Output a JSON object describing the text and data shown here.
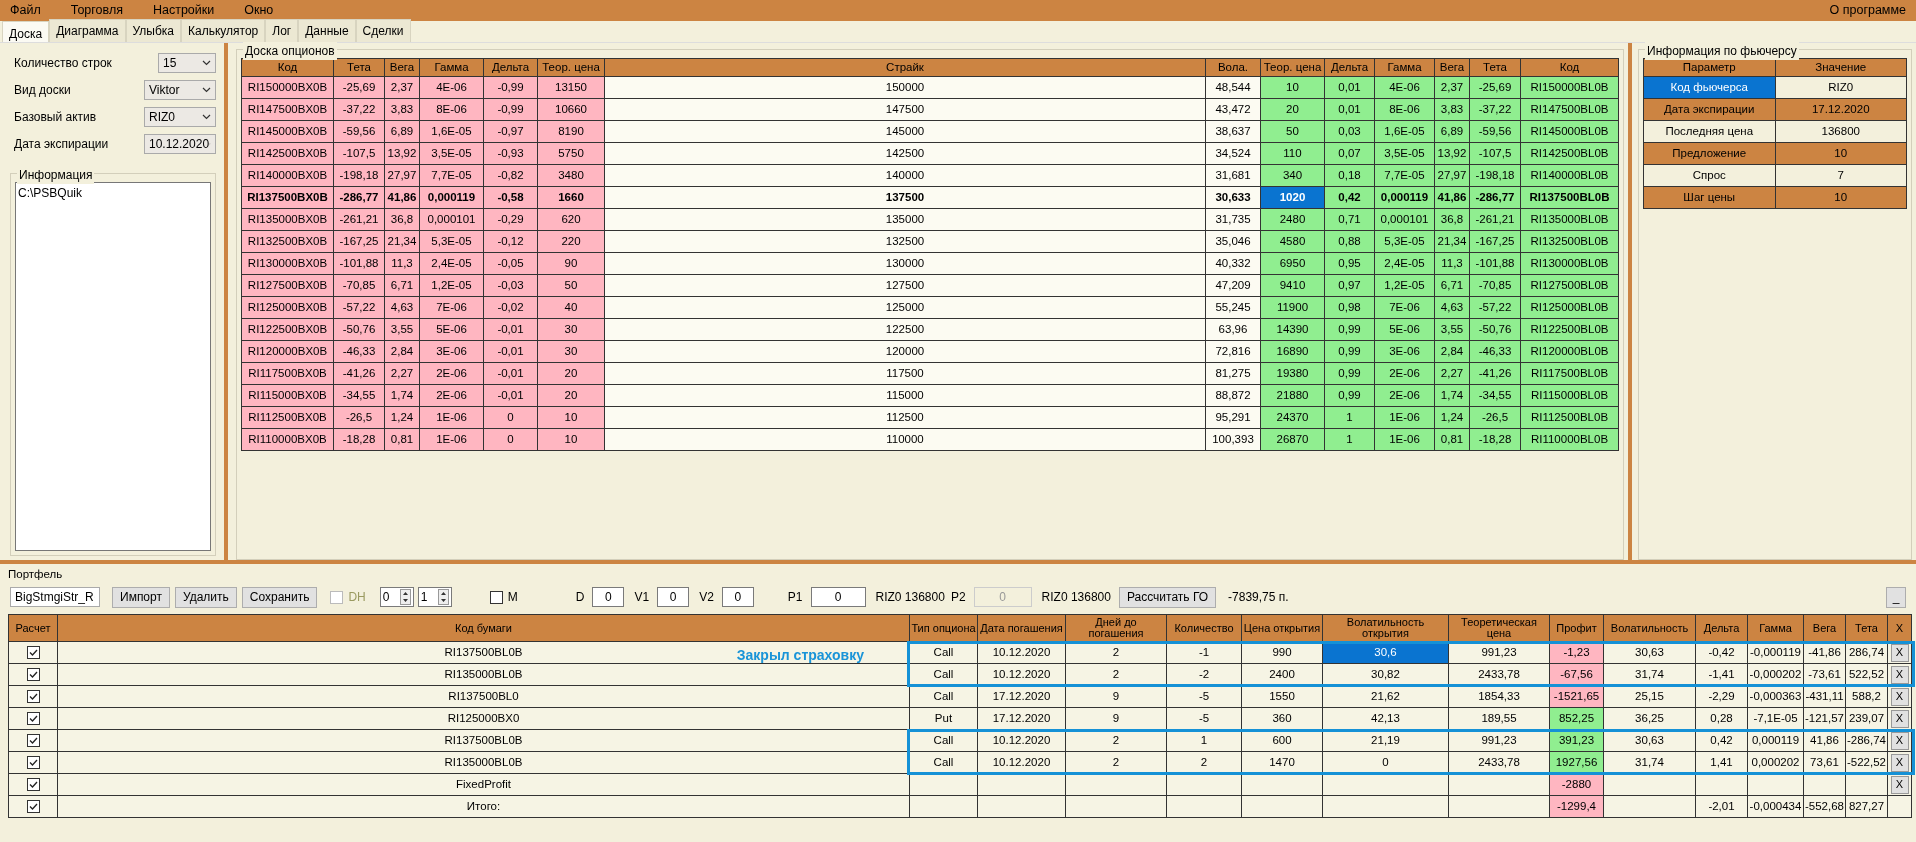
{
  "menu": [
    "Файл",
    "Торговля",
    "Настройки",
    "Окно"
  ],
  "about": "О программе",
  "tabs": [
    {
      "label": "Доска",
      "selected": true
    },
    {
      "label": "Диаграмма",
      "selected": false
    },
    {
      "label": "Улыбка",
      "selected": false
    },
    {
      "label": "Калькулятор",
      "selected": false
    },
    {
      "label": "Лог",
      "selected": false
    },
    {
      "label": "Данные",
      "selected": false
    },
    {
      "label": "Сделки",
      "selected": false
    }
  ],
  "settings": [
    {
      "label": "Количество строк",
      "value": "15"
    },
    {
      "label": "Вид доски",
      "value": "Viktor"
    },
    {
      "label": "Базовый актив",
      "value": "RIZ0"
    },
    {
      "label": "Дата экспирации",
      "value": "10.12.2020"
    }
  ],
  "info": {
    "title": "Информация",
    "text": "C:\\PSBQuik"
  },
  "board": {
    "title": "Доска опционов",
    "columns": [
      "Код",
      "Тета",
      "Вега",
      "Гамма",
      "Дельта",
      "Теор. цена",
      "Страйк",
      "Вола.",
      "Теор. цена",
      "Дельта",
      "Гамма",
      "Вега",
      "Тета",
      "Код"
    ],
    "rows": [
      {
        "put": [
          "RI150000BX0B",
          "-25,69",
          "2,37",
          "4E-06",
          "-0,99",
          "13150"
        ],
        "strike": "150000",
        "vol": "48,544",
        "call": [
          "10",
          "0,01",
          "4E-06",
          "2,37",
          "-25,69",
          "RI150000BL0B"
        ],
        "atm": false,
        "price_selected": false
      },
      {
        "put": [
          "RI147500BX0B",
          "-37,22",
          "3,83",
          "8E-06",
          "-0,99",
          "10660"
        ],
        "strike": "147500",
        "vol": "43,472",
        "call": [
          "20",
          "0,01",
          "8E-06",
          "3,83",
          "-37,22",
          "RI147500BL0B"
        ],
        "atm": false,
        "price_selected": false
      },
      {
        "put": [
          "RI145000BX0B",
          "-59,56",
          "6,89",
          "1,6E-05",
          "-0,97",
          "8190"
        ],
        "strike": "145000",
        "vol": "38,637",
        "call": [
          "50",
          "0,03",
          "1,6E-05",
          "6,89",
          "-59,56",
          "RI145000BL0B"
        ],
        "atm": false,
        "price_selected": false
      },
      {
        "put": [
          "RI142500BX0B",
          "-107,5",
          "13,92",
          "3,5E-05",
          "-0,93",
          "5750"
        ],
        "strike": "142500",
        "vol": "34,524",
        "call": [
          "110",
          "0,07",
          "3,5E-05",
          "13,92",
          "-107,5",
          "RI142500BL0B"
        ],
        "atm": false,
        "price_selected": false
      },
      {
        "put": [
          "RI140000BX0B",
          "-198,18",
          "27,97",
          "7,7E-05",
          "-0,82",
          "3480"
        ],
        "strike": "140000",
        "vol": "31,681",
        "call": [
          "340",
          "0,18",
          "7,7E-05",
          "27,97",
          "-198,18",
          "RI140000BL0B"
        ],
        "atm": false,
        "price_selected": false
      },
      {
        "put": [
          "RI137500BX0B",
          "-286,77",
          "41,86",
          "0,000119",
          "-0,58",
          "1660"
        ],
        "strike": "137500",
        "vol": "30,633",
        "call": [
          "1020",
          "0,42",
          "0,000119",
          "41,86",
          "-286,77",
          "RI137500BL0B"
        ],
        "atm": true,
        "price_selected": true
      },
      {
        "put": [
          "RI135000BX0B",
          "-261,21",
          "36,8",
          "0,000101",
          "-0,29",
          "620"
        ],
        "strike": "135000",
        "vol": "31,735",
        "call": [
          "2480",
          "0,71",
          "0,000101",
          "36,8",
          "-261,21",
          "RI135000BL0B"
        ],
        "atm": false,
        "price_selected": false
      },
      {
        "put": [
          "RI132500BX0B",
          "-167,25",
          "21,34",
          "5,3E-05",
          "-0,12",
          "220"
        ],
        "strike": "132500",
        "vol": "35,046",
        "call": [
          "4580",
          "0,88",
          "5,3E-05",
          "21,34",
          "-167,25",
          "RI132500BL0B"
        ],
        "atm": false,
        "price_selected": false
      },
      {
        "put": [
          "RI130000BX0B",
          "-101,88",
          "11,3",
          "2,4E-05",
          "-0,05",
          "90"
        ],
        "strike": "130000",
        "vol": "40,332",
        "call": [
          "6950",
          "0,95",
          "2,4E-05",
          "11,3",
          "-101,88",
          "RI130000BL0B"
        ],
        "atm": false,
        "price_selected": false
      },
      {
        "put": [
          "RI127500BX0B",
          "-70,85",
          "6,71",
          "1,2E-05",
          "-0,03",
          "50"
        ],
        "strike": "127500",
        "vol": "47,209",
        "call": [
          "9410",
          "0,97",
          "1,2E-05",
          "6,71",
          "-70,85",
          "RI127500BL0B"
        ],
        "atm": false,
        "price_selected": false
      },
      {
        "put": [
          "RI125000BX0B",
          "-57,22",
          "4,63",
          "7E-06",
          "-0,02",
          "40"
        ],
        "strike": "125000",
        "vol": "55,245",
        "call": [
          "11900",
          "0,98",
          "7E-06",
          "4,63",
          "-57,22",
          "RI125000BL0B"
        ],
        "atm": false,
        "price_selected": false
      },
      {
        "put": [
          "RI122500BX0B",
          "-50,76",
          "3,55",
          "5E-06",
          "-0,01",
          "30"
        ],
        "strike": "122500",
        "vol": "63,96",
        "call": [
          "14390",
          "0,99",
          "5E-06",
          "3,55",
          "-50,76",
          "RI122500BL0B"
        ],
        "atm": false,
        "price_selected": false
      },
      {
        "put": [
          "RI120000BX0B",
          "-46,33",
          "2,84",
          "3E-06",
          "-0,01",
          "30"
        ],
        "strike": "120000",
        "vol": "72,816",
        "call": [
          "16890",
          "0,99",
          "3E-06",
          "2,84",
          "-46,33",
          "RI120000BL0B"
        ],
        "atm": false,
        "price_selected": false
      },
      {
        "put": [
          "RI117500BX0B",
          "-41,26",
          "2,27",
          "2E-06",
          "-0,01",
          "20"
        ],
        "strike": "117500",
        "vol": "81,275",
        "call": [
          "19380",
          "0,99",
          "2E-06",
          "2,27",
          "-41,26",
          "RI117500BL0B"
        ],
        "atm": false,
        "price_selected": false
      },
      {
        "put": [
          "RI115000BX0B",
          "-34,55",
          "1,74",
          "2E-06",
          "-0,01",
          "20"
        ],
        "strike": "115000",
        "vol": "88,872",
        "call": [
          "21880",
          "0,99",
          "2E-06",
          "1,74",
          "-34,55",
          "RI115000BL0B"
        ],
        "atm": false,
        "price_selected": false
      },
      {
        "put": [
          "RI112500BX0B",
          "-26,5",
          "1,24",
          "1E-06",
          "0",
          "10"
        ],
        "strike": "112500",
        "vol": "95,291",
        "call": [
          "24370",
          "1",
          "1E-06",
          "1,24",
          "-26,5",
          "RI112500BL0B"
        ],
        "atm": false,
        "price_selected": false
      },
      {
        "put": [
          "RI110000BX0B",
          "-18,28",
          "0,81",
          "1E-06",
          "0",
          "10"
        ],
        "strike": "110000",
        "vol": "100,393",
        "call": [
          "26870",
          "1",
          "1E-06",
          "0,81",
          "-18,28",
          "RI110000BL0B"
        ],
        "atm": false,
        "price_selected": false
      }
    ]
  },
  "futures": {
    "title": "Информация по фьючерсу",
    "columns": [
      "Параметр",
      "Значение"
    ],
    "rows": [
      {
        "param": "Код фьючерса",
        "value": "RIZ0",
        "selected": true
      },
      {
        "param": "Дата экспирации",
        "value": "17.12.2020",
        "selected": false
      },
      {
        "param": "Последняя цена",
        "value": "136800",
        "selected": false
      },
      {
        "param": "Предложение",
        "value": "10",
        "selected": false
      },
      {
        "param": "Спрос",
        "value": "7",
        "selected": false
      },
      {
        "param": "Шаг цены",
        "value": "10",
        "selected": false
      }
    ]
  },
  "portfolio": {
    "title": "Портфель",
    "toolbar": {
      "strategy": "BigStmgiStr_R",
      "buttons": [
        "Импорт",
        "Удалить",
        "Сохранить"
      ],
      "dh": {
        "label": "DH",
        "checked": false,
        "disabled": true
      },
      "spinners": [
        "0",
        "1"
      ],
      "m": {
        "label": "M",
        "checked": false
      },
      "fields": [
        {
          "label": "D",
          "value": "0"
        },
        {
          "label": "V1",
          "value": "0"
        },
        {
          "label": "V2",
          "value": "0"
        },
        {
          "label": "P1",
          "value": "0"
        }
      ],
      "p1_price": "RIZ0 136800",
      "p2": {
        "label": "P2",
        "value": "0",
        "disabled": true
      },
      "p2_price": "RIZ0 136800",
      "calc_button": "Рассчитать ГО",
      "go_value": "-7839,75 п.",
      "minimize": "_"
    },
    "columns": [
      "Расчет",
      "Код бумаги",
      "Тип опциона",
      "Дата погашения",
      "Дней до погашения",
      "Количество",
      "Цена открытия",
      "Волатильность открытия",
      "Теоретическая цена",
      "Профит",
      "Волатильность",
      "Дельта",
      "Гамма",
      "Вега",
      "Тета",
      "X"
    ],
    "rows": [
      {
        "checked": true,
        "code": "RI137500BL0B",
        "note": "Закрыл страховку",
        "type": "Call",
        "date": "10.12.2020",
        "days": "2",
        "qty": "-1",
        "open_price": "990",
        "open_vol": "30,6",
        "open_vol_selected": true,
        "theor": "991,23",
        "profit": "-1,23",
        "color": "#ffb6c1",
        "vol": "30,63",
        "delta": "-0,42",
        "gamma": "-0,000119",
        "vega": "-41,86",
        "theta": "286,74",
        "remove": "X",
        "framed": true
      },
      {
        "checked": true,
        "code": "RI135000BL0B",
        "type": "Call",
        "date": "10.12.2020",
        "days": "2",
        "qty": "-2",
        "open_price": "2400",
        "open_vol": "30,82",
        "open_vol_selected": false,
        "theor": "2433,78",
        "profit": "-67,56",
        "color": "#ffb6c1",
        "vol": "31,74",
        "delta": "-1,41",
        "gamma": "-0,000202",
        "vega": "-73,61",
        "theta": "522,52",
        "remove": "X",
        "framed": true
      },
      {
        "checked": true,
        "code": "RI137500BL0",
        "type": "Call",
        "date": "17.12.2020",
        "days": "9",
        "qty": "-5",
        "open_price": "1550",
        "open_vol": "21,62",
        "open_vol_selected": false,
        "theor": "1854,33",
        "profit": "-1521,65",
        "color": "#ffb6c1",
        "vol": "25,15",
        "delta": "-2,29",
        "gamma": "-0,000363",
        "vega": "-431,11",
        "theta": "588,2",
        "remove": "X",
        "framed": false
      },
      {
        "checked": true,
        "code": "RI125000BX0",
        "type": "Put",
        "date": "17.12.2020",
        "days": "9",
        "qty": "-5",
        "open_price": "360",
        "open_vol": "42,13",
        "open_vol_selected": false,
        "theor": "189,55",
        "profit": "852,25",
        "color": "#90ee90",
        "vol": "36,25",
        "delta": "0,28",
        "gamma": "-7,1E-05",
        "vega": "-121,57",
        "theta": "239,07",
        "remove": "X",
        "framed": false
      },
      {
        "checked": true,
        "code": "RI137500BL0B",
        "type": "Call",
        "date": "10.12.2020",
        "days": "2",
        "qty": "1",
        "open_price": "600",
        "open_vol": "21,19",
        "open_vol_selected": false,
        "theor": "991,23",
        "profit": "391,23",
        "color": "#90ee90",
        "vol": "30,63",
        "delta": "0,42",
        "gamma": "0,000119",
        "vega": "41,86",
        "theta": "-286,74",
        "remove": "X",
        "framed": true
      },
      {
        "checked": true,
        "code": "RI135000BL0B",
        "type": "Call",
        "date": "10.12.2020",
        "days": "2",
        "qty": "2",
        "open_price": "1470",
        "open_vol": "0",
        "open_vol_selected": false,
        "theor": "2433,78",
        "profit": "1927,56",
        "color": "#90ee90",
        "vol": "31,74",
        "delta": "1,41",
        "gamma": "0,000202",
        "vega": "73,61",
        "theta": "-522,52",
        "remove": "X",
        "framed": true
      },
      {
        "checked": true,
        "code": "FixedProfit",
        "profit": "-2880",
        "color": "#ffb6c1",
        "remove": "X",
        "framed": false
      },
      {
        "checked": true,
        "code": "Итого:",
        "profit": "-1299,4",
        "color": "#ffb6c1",
        "delta": "-2,01",
        "gamma": "-0,000434",
        "vega": "-552,68",
        "theta": "827,27",
        "framed": false
      }
    ]
  }
}
